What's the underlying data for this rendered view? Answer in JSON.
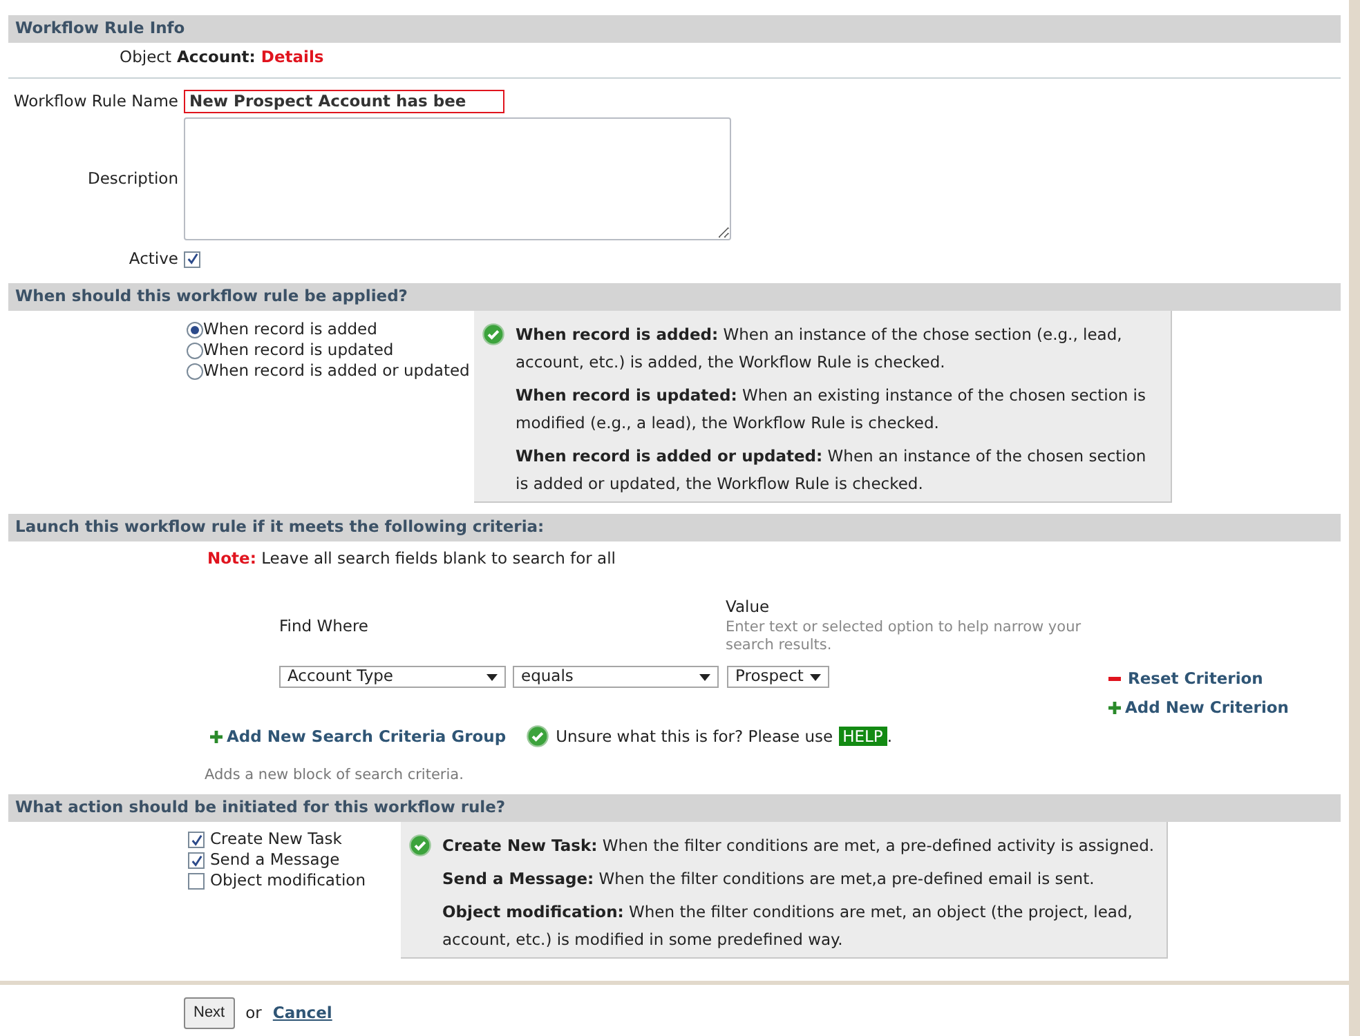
{
  "sections": [
    {
      "kind": "info",
      "title": "Workflow Rule Info",
      "object": {
        "label": "Object",
        "entity": "Account:",
        "detail": "Details"
      },
      "name_field": {
        "label": "Workflow Rule Name",
        "value": "New Prospect Account has bee"
      },
      "description": {
        "label": "Description"
      },
      "active": {
        "label": "Active",
        "checked": true
      }
    },
    {
      "kind": "trigger",
      "title": "When should this workflow rule be applied?",
      "options": [
        {
          "label": "When record is added",
          "selected": true
        },
        {
          "label": "When record is updated",
          "selected": false
        },
        {
          "label": "When record is added or updated",
          "selected": false
        }
      ],
      "help": [
        {
          "term": "When record is added:",
          "text": "When an instance of the chose section (e.g., lead, account, etc.) is added, the Workflow Rule is checked."
        },
        {
          "term": "When record is updated:",
          "text": "When an existing instance of the chosen section is modified (e.g., a lead), the Workflow Rule is checked."
        },
        {
          "term": "When record is added or updated:",
          "text": "When an instance of the chosen section is added or updated, the Workflow Rule is checked."
        }
      ]
    },
    {
      "kind": "criteria",
      "title": "Launch this workflow rule if it meets the following criteria:",
      "note": {
        "label": "Note:",
        "text": "Leave all search fields blank to search for all"
      },
      "find_where": "Find Where",
      "value_label": "Value",
      "value_hint": "Enter text or selected option to help narrow your search results.",
      "field": "Account Type",
      "operator": "equals",
      "value": "Prospect",
      "reset": "Reset Criterion",
      "add_criterion": "Add New Criterion",
      "add_group": "Add New Search Criteria Group",
      "add_group_hint": "Adds a new block of search criteria.",
      "help_text": "Unsure what this is for? Please use",
      "help_button": "HELP",
      "help_end": "."
    },
    {
      "kind": "actions",
      "title": "What action should be initiated for this workflow rule?",
      "options": [
        {
          "label": "Create New Task",
          "checked": true
        },
        {
          "label": "Send a Message",
          "checked": true
        },
        {
          "label": "Object modification",
          "checked": false
        }
      ],
      "help": [
        {
          "term": "Create New Task:",
          "text": "When the filter conditions are met, a pre-defined activity is assigned."
        },
        {
          "term": "Send a Message:",
          "text": "When the filter conditions are met,a pre-defined email is sent."
        },
        {
          "term": "Object modification:",
          "text": "When the filter conditions are met, an object (the project, lead, account, etc.) is modified in some predefined way."
        }
      ]
    }
  ],
  "footer": {
    "next": "Next",
    "or": "or",
    "cancel": "Cancel"
  }
}
